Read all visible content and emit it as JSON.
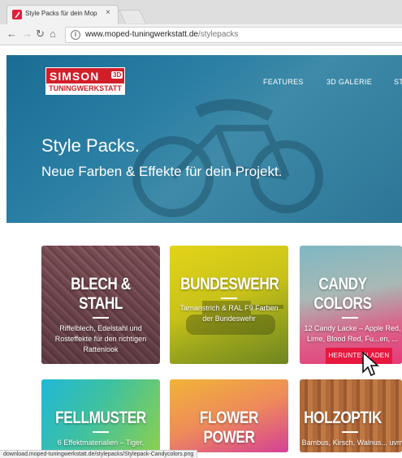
{
  "browser": {
    "tab_title": "Style Packs für dein Mop",
    "tab_close": "×",
    "url_host": "www.moped-tuningwerkstatt.de",
    "url_path": "/stylepacks",
    "status_url": "download.moped-tuningwerkstatt.de/stylepacks/Stylepack-Candycolors.png"
  },
  "site": {
    "logo_top": "SIMSON",
    "logo_3d": "3D",
    "logo_bottom": "TUNINGWERKSTATT",
    "nav": [
      "FEATURES",
      "3D GALERIE",
      "ST"
    ]
  },
  "hero": {
    "title": "Style Packs.",
    "subtitle": "Neue Farben & Effekte für dein Projekt."
  },
  "cards": [
    {
      "title_line1": "BLECH &",
      "title_line2": "STAHL",
      "desc": "Riffelblech, Edelstahl und Rosteffekte für den richtigen Rattenlook"
    },
    {
      "title_line1": "BUNDESWEHR",
      "desc": "Tarnanstrich & RAL F9 Farben der Bundeswehr"
    },
    {
      "title_line1": "CANDY",
      "title_line2": "COLORS",
      "desc": "12 Candy Lacke – Apple Red, Lime, Blood Red, Fu...en, ...",
      "button": "HERUNTERLADEN"
    },
    {
      "title_line1": "FELLMUSTER",
      "desc": "6 Effektmaterialien – Tiger,"
    },
    {
      "title_line1": "FLOWER",
      "title_line2": "POWER"
    },
    {
      "title_line1": "HOLZOPTIK",
      "desc": "Bambus, Kirsch, Walnus... uvm"
    }
  ],
  "colors": {
    "brand_red": "#d11f2a",
    "download_red": "#e8173f",
    "hero_blue": "#1a6c93"
  }
}
